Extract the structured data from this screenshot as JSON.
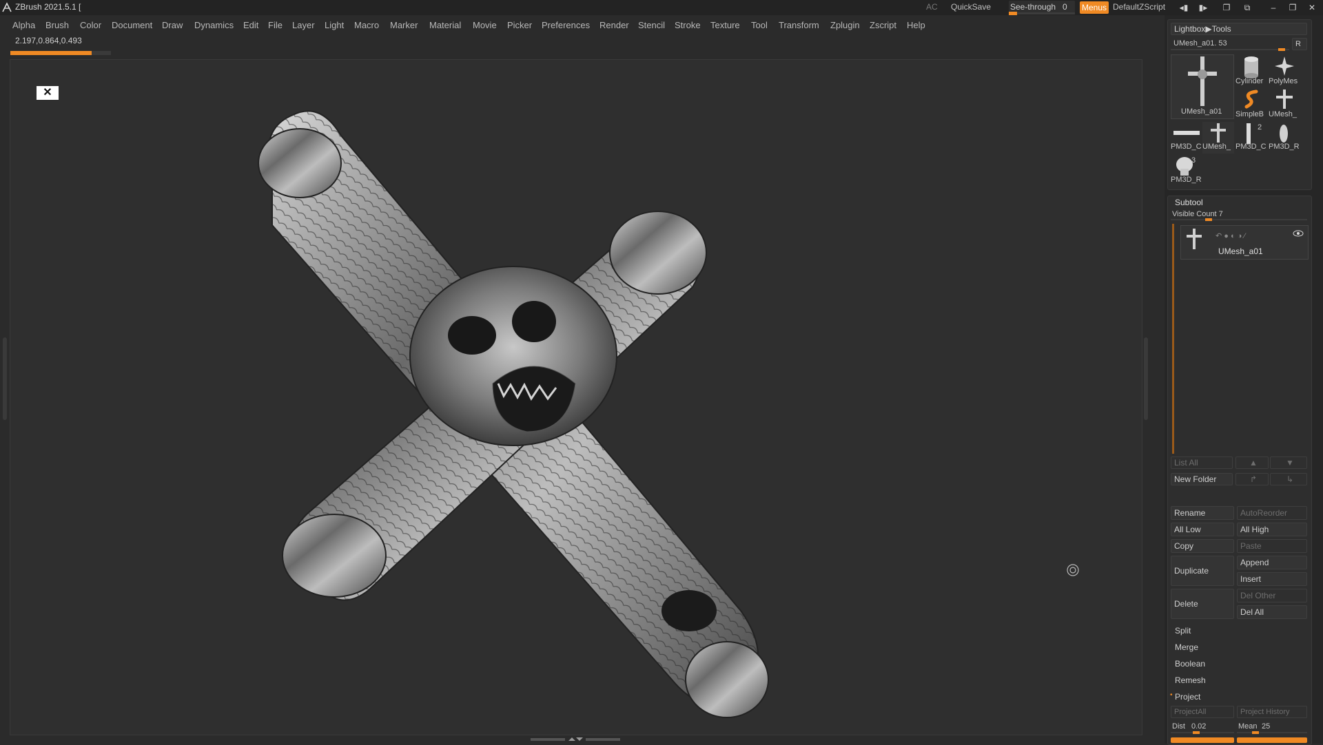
{
  "app": {
    "title": "ZBrush 2021.5.1 ["
  },
  "titlebar": {
    "ac": "AC",
    "quicksave": "QuickSave",
    "see_through_label": "See-through",
    "see_through_value": "0",
    "menus": "Menus",
    "script": "DefaultZScript"
  },
  "menu": [
    "Alpha",
    "Brush",
    "Color",
    "Document",
    "Draw",
    "Dynamics",
    "Edit",
    "File",
    "Layer",
    "Light",
    "Macro",
    "Marker",
    "Material",
    "Movie",
    "Picker",
    "Preferences",
    "Render",
    "Stencil",
    "Stroke",
    "Texture",
    "Tool",
    "Transform",
    "Zplugin",
    "Zscript",
    "Help"
  ],
  "status": {
    "coordinates": "2.197,0.864,0.493",
    "progress_fraction": 0.81
  },
  "canvas": {
    "close_badge": "✕"
  },
  "tool_panel": {
    "breadcrumb": "Lightbox▶Tools",
    "current_tool": "UMesh_a01. 53",
    "r_button": "R",
    "tools": [
      {
        "label": "UMesh_a01",
        "icon": "cross-skull-icon"
      },
      {
        "label": "Cylinder",
        "icon": "cylinder-icon"
      },
      {
        "label": "PolyMes",
        "icon": "star-icon"
      },
      {
        "label": "SimpleB",
        "icon": "simplebrush-icon"
      },
      {
        "label": "UMesh_",
        "icon": "cross-icon"
      },
      {
        "label": "PM3D_C",
        "icon": "bar-icon"
      },
      {
        "label": "UMesh_",
        "icon": "cross-skull-icon"
      },
      {
        "label": "PM3D_C",
        "icon": "pillar-icon",
        "badge": "2"
      },
      {
        "label": "PM3D_R",
        "icon": "ring-icon"
      },
      {
        "label": "PM3D_R",
        "icon": "skull-icon",
        "badge": "3"
      }
    ]
  },
  "subtool": {
    "header": "Subtool",
    "visible_count": "Visible Count 7",
    "item_name": "UMesh_a01",
    "list_all": "List All",
    "new_folder": "New Folder",
    "rename": "Rename",
    "auto_reorder": "AutoReorder",
    "all_low": "All Low",
    "all_high": "All High",
    "copy": "Copy",
    "paste": "Paste",
    "duplicate": "Duplicate",
    "append": "Append",
    "insert": "Insert",
    "delete": "Delete",
    "del_other": "Del Other",
    "del_all": "Del All",
    "split": "Split",
    "merge": "Merge",
    "boolean": "Boolean",
    "remesh": "Remesh",
    "project": "Project",
    "project_all": "ProjectAll",
    "project_history": "Project History",
    "dist_label": "Dist",
    "dist_value": "0.02",
    "mean_label": "Mean",
    "mean_value": "25"
  }
}
